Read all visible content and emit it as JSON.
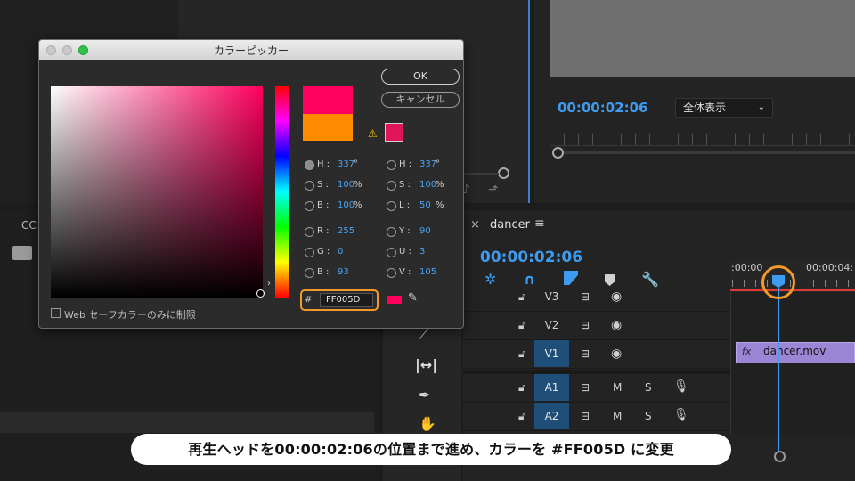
{
  "program_monitor": {
    "timecode": "00:00:02:06",
    "zoom_select": "全体表示"
  },
  "source_panel": {
    "tab_label": "CC"
  },
  "color_picker": {
    "title": "カラーピッカー",
    "ok_label": "OK",
    "cancel_label": "キャンセル",
    "hsb": [
      {
        "label": "H :",
        "value": "337",
        "unit": "°"
      },
      {
        "label": "S :",
        "value": "100",
        "unit": "%"
      },
      {
        "label": "B :",
        "value": "100",
        "unit": "%"
      }
    ],
    "rgb": [
      {
        "label": "R :",
        "value": "255"
      },
      {
        "label": "G :",
        "value": "0"
      },
      {
        "label": "B :",
        "value": "93"
      }
    ],
    "hsl": [
      {
        "label": "H :",
        "value": "337",
        "unit": "°"
      },
      {
        "label": "S :",
        "value": "100",
        "unit": "%"
      },
      {
        "label": "L :",
        "value": "50",
        "unit": "%"
      }
    ],
    "yuv": [
      {
        "label": "Y :",
        "value": "90"
      },
      {
        "label": "U :",
        "value": "3"
      },
      {
        "label": "V :",
        "value": "105"
      }
    ],
    "hex_prefix": "#",
    "hex_value": "FF005D",
    "web_safe_label": "Web セーフカラーのみに制限",
    "new_color": "#ff005d",
    "old_color": "#ff8c00",
    "gamut_swatch": "#e0145a"
  },
  "timeline": {
    "sequence_name": "dancer",
    "timecode": "00:00:02:06",
    "ruler_labels": [
      ":00:00",
      "00:00:04:"
    ],
    "tracks": [
      {
        "name": "V3",
        "selected": false,
        "kind": "video"
      },
      {
        "name": "V2",
        "selected": false,
        "kind": "video"
      },
      {
        "name": "V1",
        "selected": true,
        "kind": "video"
      },
      {
        "name": "A1",
        "selected": true,
        "kind": "audio"
      },
      {
        "name": "A2",
        "selected": true,
        "kind": "audio"
      }
    ],
    "audio_m": "M",
    "audio_s": "S",
    "clip_fx": "fx",
    "clip_name": "dancer.mov"
  },
  "caption": "再生ヘッドを00:00:02:06の位置まで進め、カラーを #FF005D に変更",
  "colors": {
    "accent_blue": "#3e9cf0",
    "highlight_orange": "#f39a2b",
    "clip_purple": "#9b86d6"
  }
}
